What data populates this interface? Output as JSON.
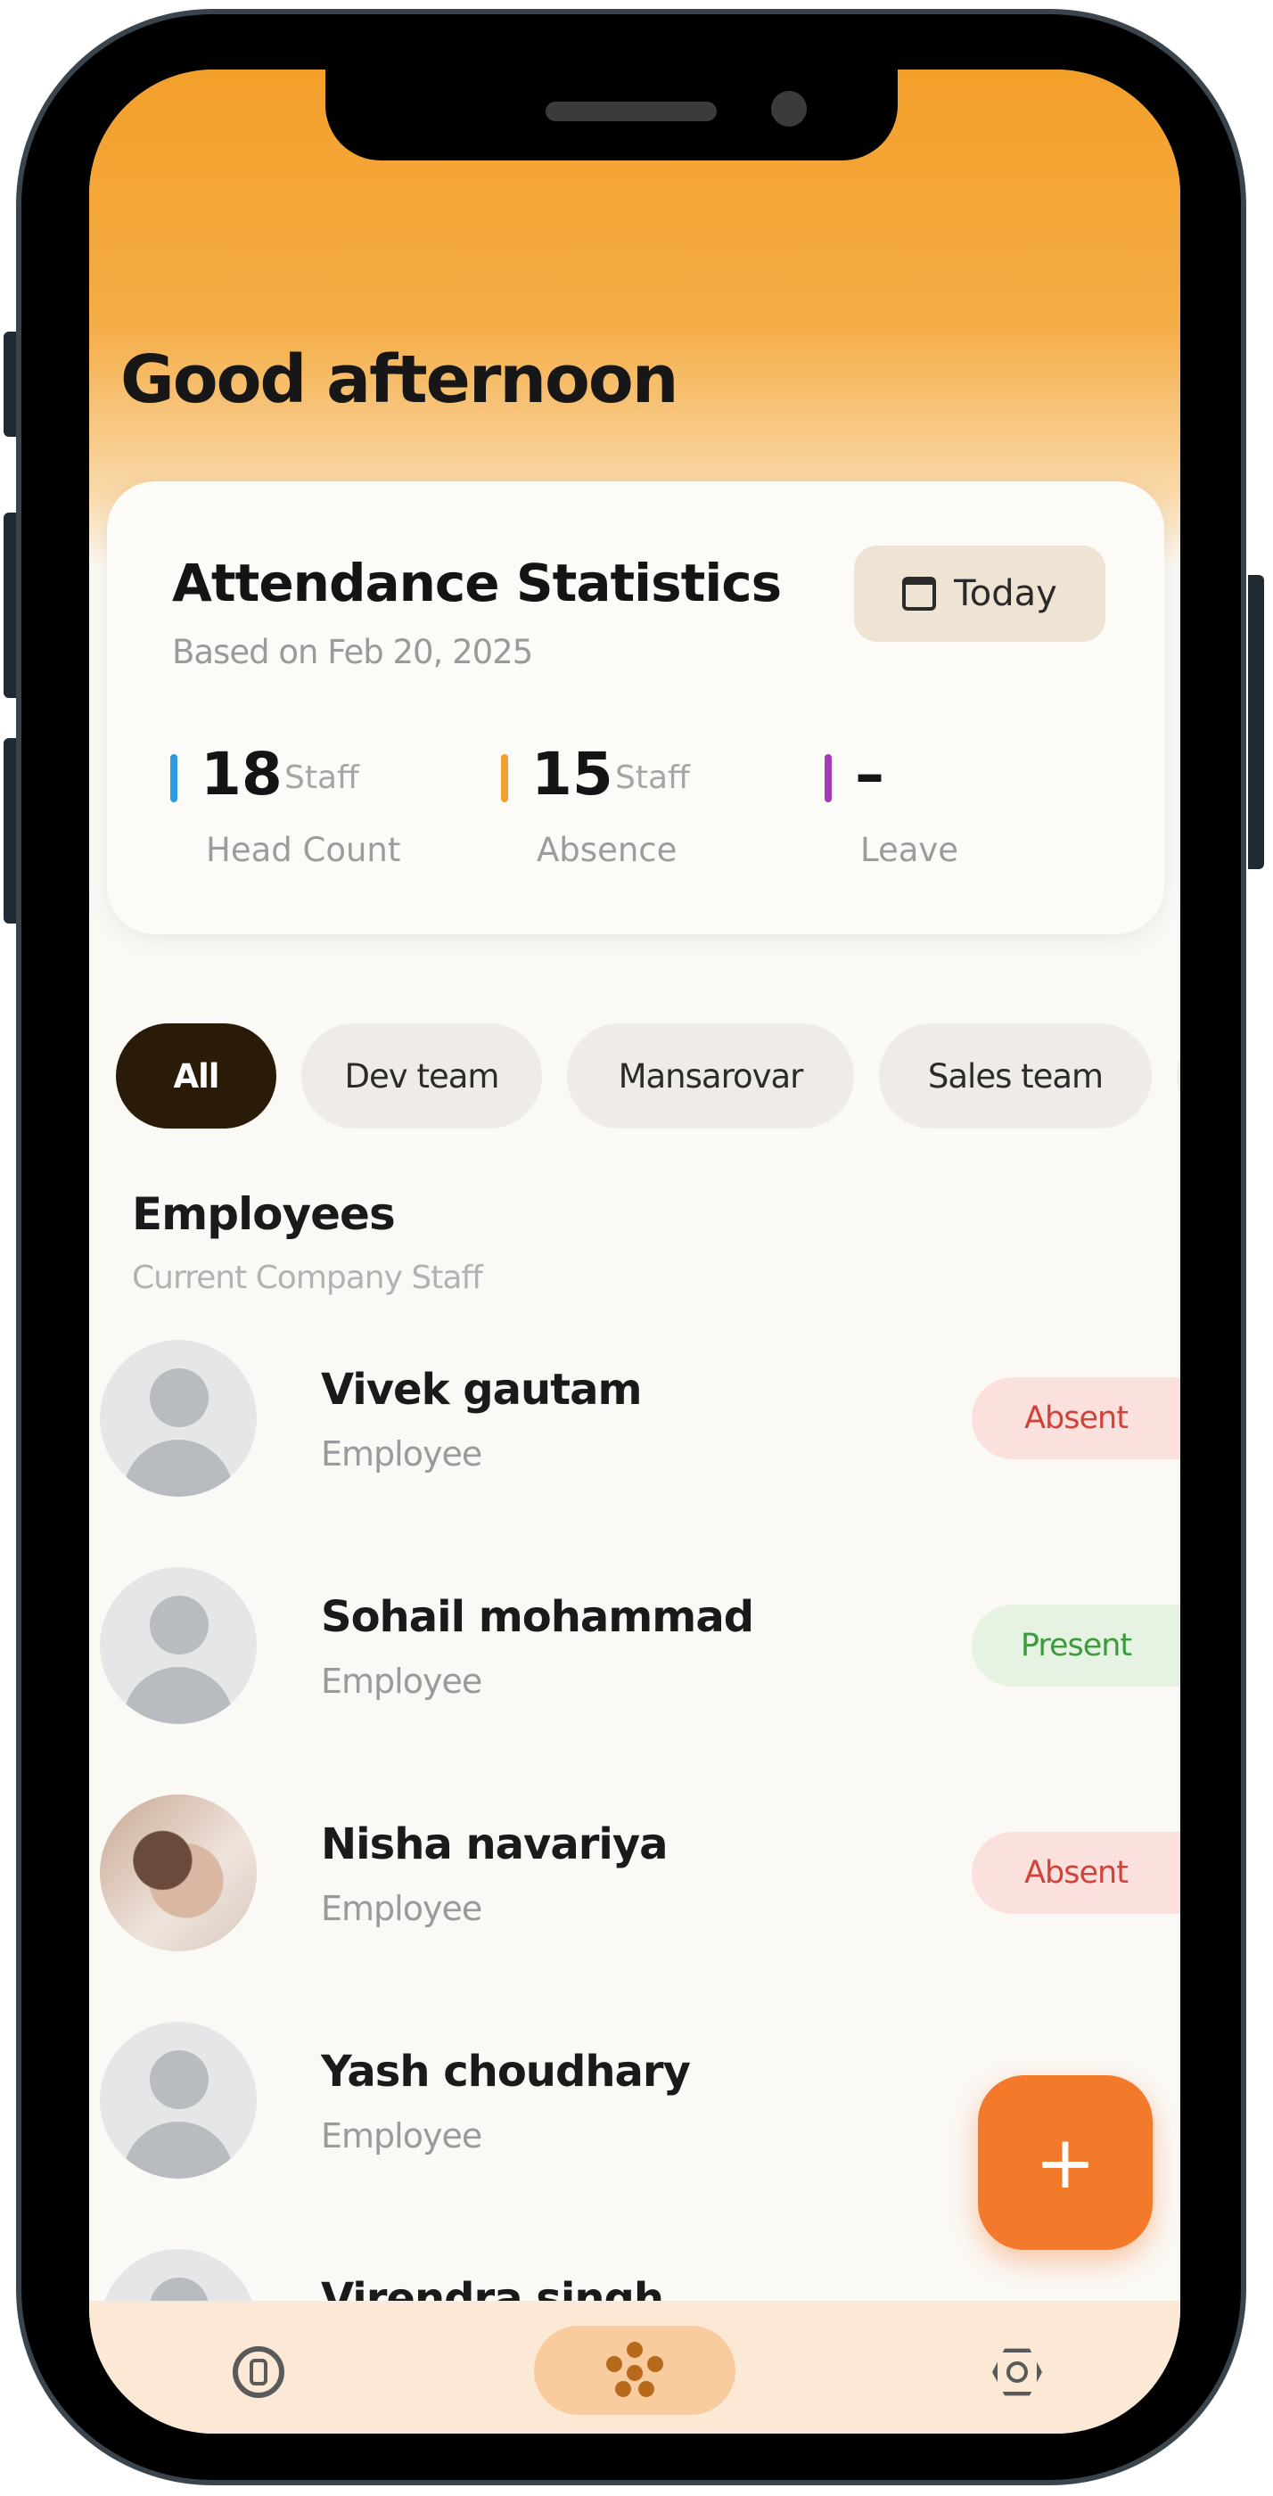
{
  "header": {
    "greeting": "Good afternoon"
  },
  "stats": {
    "title": "Attendance Statistics",
    "subtitle": "Based on Feb 20, 2025",
    "date_button_label": "Today",
    "items": [
      {
        "value": "18",
        "unit": "Staff",
        "label": "Head Count",
        "color": "#2e9be0"
      },
      {
        "value": "15",
        "unit": "Staff",
        "label": "Absence",
        "color": "#f0a030"
      },
      {
        "value": "–",
        "unit": "",
        "label": "Leave",
        "color": "#a43ab5"
      }
    ]
  },
  "filters": [
    "All",
    "Dev team",
    "Mansarovar",
    "Sales team"
  ],
  "employees_section": {
    "title": "Employees",
    "subtitle": "Current Company Staff",
    "list": [
      {
        "name": "Vivek gautam",
        "role": "Employee",
        "status": "Absent"
      },
      {
        "name": "Sohail mohammad",
        "role": "Employee",
        "status": "Present"
      },
      {
        "name": "Nisha navariya",
        "role": "Employee",
        "status": "Absent"
      },
      {
        "name": "Yash choudhary",
        "role": "Employee",
        "status": ""
      },
      {
        "name": "Virendra singh",
        "role": "",
        "status": ""
      }
    ]
  },
  "fab": {
    "icon": "plus-icon",
    "label": "+"
  },
  "bottom_nav": [
    {
      "icon": "home-icon"
    },
    {
      "icon": "team-icon",
      "active": true
    },
    {
      "icon": "settings-icon"
    }
  ],
  "colors": {
    "accent": "#f3a02a",
    "fab": "#f27a2a",
    "absent": "#d0423a",
    "present": "#3d9a3d"
  }
}
